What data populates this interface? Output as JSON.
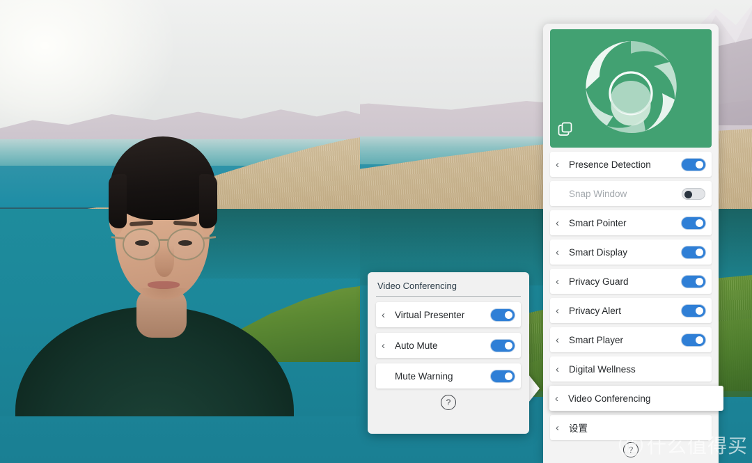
{
  "colors": {
    "app_accent_green": "#42a172",
    "toggle_on_blue": "#2f7fd6",
    "toggle_off_gray": "#e3e5e8",
    "panel_background": "#f3f3f3",
    "row_background": "#ffffff",
    "desktop_teal": "#2d5f6b"
  },
  "app_panel": {
    "hero": {
      "logo_icon": "camera-aperture-shutter-icon",
      "window_icon": "duplicate-windows-icon"
    },
    "items": [
      {
        "label": "Presence Detection",
        "chevron": "‹",
        "toggle": "on",
        "disabled": false,
        "selected": false
      },
      {
        "label": "Snap Window",
        "chevron": "‹",
        "toggle": "off",
        "disabled": true,
        "selected": false
      },
      {
        "label": "Smart Pointer",
        "chevron": "‹",
        "toggle": "on",
        "disabled": false,
        "selected": false
      },
      {
        "label": "Smart Display",
        "chevron": "‹",
        "toggle": "on",
        "disabled": false,
        "selected": false
      },
      {
        "label": "Privacy Guard",
        "chevron": "‹",
        "toggle": "on",
        "disabled": false,
        "selected": false
      },
      {
        "label": "Privacy Alert",
        "chevron": "‹",
        "toggle": "on",
        "disabled": false,
        "selected": false
      },
      {
        "label": "Smart Player",
        "chevron": "‹",
        "toggle": "on",
        "disabled": false,
        "selected": false
      },
      {
        "label": "Digital Wellness",
        "chevron": "‹",
        "toggle": "none",
        "disabled": false,
        "selected": false
      },
      {
        "label": "Video Conferencing",
        "chevron": "‹",
        "toggle": "none",
        "disabled": false,
        "selected": true
      },
      {
        "label": "设置",
        "chevron": "‹",
        "toggle": "none",
        "disabled": false,
        "selected": false
      }
    ],
    "help_label": "?"
  },
  "sub_panel": {
    "title": "Video Conferencing",
    "items": [
      {
        "label": "Virtual Presenter",
        "chevron": "‹",
        "toggle": "on",
        "has_chevron": true
      },
      {
        "label": "Auto Mute",
        "chevron": "‹",
        "toggle": "on",
        "has_chevron": true
      },
      {
        "label": "Mute Warning",
        "chevron": "‹",
        "toggle": "on",
        "has_chevron": false
      }
    ],
    "help_label": "?"
  },
  "watermark": {
    "badge_text": "值",
    "text": "什么值得买"
  }
}
